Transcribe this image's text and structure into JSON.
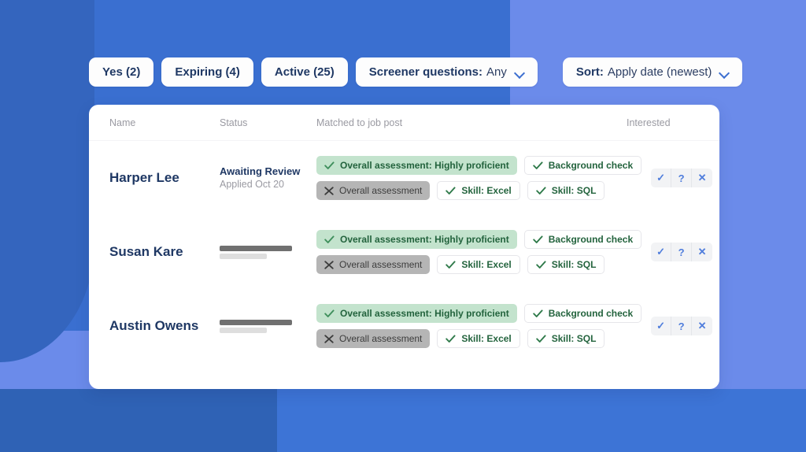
{
  "background": {
    "primary": "#6b8bea",
    "panel_dark": "#3a6fd0",
    "deep": "#3465be",
    "bottom_left": "#2f62b5",
    "bottom_right": "#3d74d6"
  },
  "filters": [
    {
      "label": "Yes (2)",
      "type": "pill",
      "name": "filter-yes"
    },
    {
      "label": "Expiring (4)",
      "type": "pill",
      "name": "filter-expiring"
    },
    {
      "label": "Active (25)",
      "type": "pill",
      "name": "filter-active"
    },
    {
      "label": "Screener questions:",
      "value": "Any",
      "type": "dropdown",
      "name": "filter-screener-questions"
    },
    {
      "label": "Sort:",
      "value": "Apply date (newest)",
      "type": "dropdown",
      "name": "filter-sort"
    }
  ],
  "table": {
    "headers": {
      "name": "Name",
      "status": "Status",
      "matched": "Matched to job post",
      "interested": "Interested"
    },
    "rows": [
      {
        "name": "Harper Lee",
        "status_title": "Awaiting Review",
        "status_sub": "Applied Oct 20",
        "status_is_skeleton": false,
        "chips_row1": [
          {
            "label": "Overall assessment: Highly proficient",
            "icon": "check-icon",
            "style": "green-fill"
          },
          {
            "label": "Background check",
            "icon": "check-icon",
            "style": "outline"
          }
        ],
        "chips_row2": [
          {
            "label": "Overall assessment",
            "icon": "cross-icon",
            "style": "gray-fill"
          },
          {
            "label": "Skill: Excel",
            "icon": "check-icon",
            "style": "outline"
          },
          {
            "label": "Skill: SQL",
            "icon": "check-icon",
            "style": "outline"
          }
        ],
        "interested": [
          {
            "label": "✓",
            "name": "interested-yes-button"
          },
          {
            "label": "?",
            "name": "interested-maybe-button"
          },
          {
            "label": "✕",
            "name": "interested-no-button"
          }
        ]
      },
      {
        "name": "Susan Kare",
        "status_title": "",
        "status_sub": "",
        "status_is_skeleton": true,
        "chips_row1": [
          {
            "label": "Overall assessment: Highly proficient",
            "icon": "check-icon",
            "style": "green-fill"
          },
          {
            "label": "Background check",
            "icon": "check-icon",
            "style": "outline"
          }
        ],
        "chips_row2": [
          {
            "label": "Overall assessment",
            "icon": "cross-icon",
            "style": "gray-fill"
          },
          {
            "label": "Skill: Excel",
            "icon": "check-icon",
            "style": "outline"
          },
          {
            "label": "Skill: SQL",
            "icon": "check-icon",
            "style": "outline"
          }
        ],
        "interested": [
          {
            "label": "✓",
            "name": "interested-yes-button"
          },
          {
            "label": "?",
            "name": "interested-maybe-button"
          },
          {
            "label": "✕",
            "name": "interested-no-button"
          }
        ]
      },
      {
        "name": "Austin Owens",
        "status_title": "",
        "status_sub": "",
        "status_is_skeleton": true,
        "chips_row1": [
          {
            "label": "Overall assessment: Highly proficient",
            "icon": "check-icon",
            "style": "green-fill"
          },
          {
            "label": "Background check",
            "icon": "check-icon",
            "style": "outline"
          }
        ],
        "chips_row2": [
          {
            "label": "Overall assessment",
            "icon": "cross-icon",
            "style": "gray-fill"
          },
          {
            "label": "Skill: Excel",
            "icon": "check-icon",
            "style": "outline"
          },
          {
            "label": "Skill: SQL",
            "icon": "check-icon",
            "style": "outline"
          }
        ],
        "interested": [
          {
            "label": "✓",
            "name": "interested-yes-button"
          },
          {
            "label": "?",
            "name": "interested-maybe-button"
          },
          {
            "label": "✕",
            "name": "interested-no-button"
          }
        ]
      }
    ]
  },
  "colors": {
    "accent_blue": "#4f7ddc",
    "navy_text": "#1f3864",
    "chip_green_bg": "#c3e3cd",
    "chip_green_text": "#23633d",
    "chip_gray_bg": "#b5b5b5",
    "muted_text": "#9a9aa2"
  }
}
